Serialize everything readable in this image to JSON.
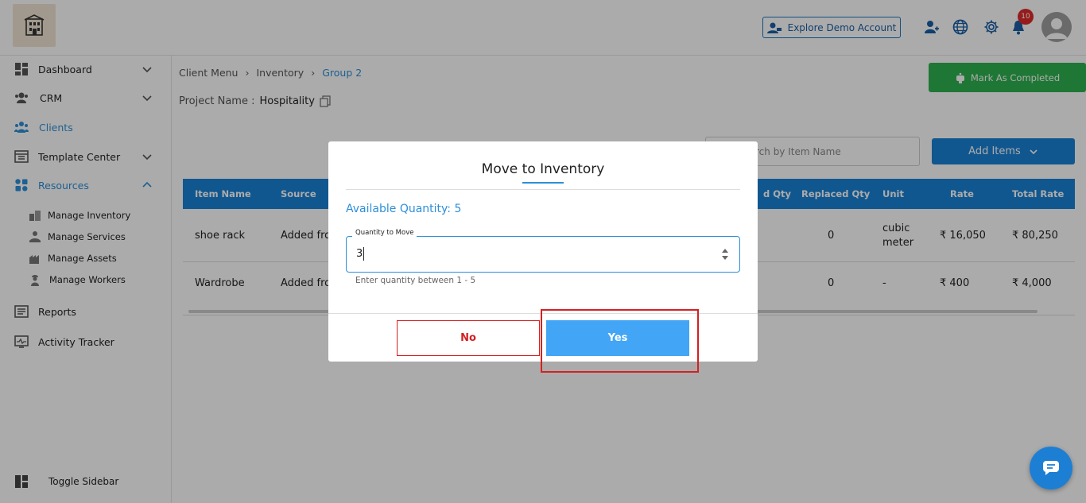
{
  "header": {
    "demo_button": "Explore Demo Account",
    "notification_count": "10"
  },
  "sidebar": {
    "items": [
      {
        "label": "Dashboard"
      },
      {
        "label": "CRM"
      },
      {
        "label": "Clients"
      },
      {
        "label": "Template Center"
      },
      {
        "label": "Resources"
      },
      {
        "label": "Reports"
      },
      {
        "label": "Activity Tracker"
      }
    ],
    "resources_sub": [
      {
        "label": "Manage Inventory"
      },
      {
        "label": "Manage Services"
      },
      {
        "label": "Manage Assets"
      },
      {
        "label": "Manage Workers"
      }
    ],
    "toggle_label": "Toggle Sidebar"
  },
  "breadcrumb": [
    "Client Menu",
    "Inventory",
    "Group 2"
  ],
  "project": {
    "label": "Project Name :",
    "value": "Hospitality"
  },
  "toolbar": {
    "mark_completed": "Mark As Completed",
    "search_placeholder": "Search by Item Name",
    "search_visible": "rch by Item Name",
    "add_items": "Add Items"
  },
  "table": {
    "headers": [
      "Item Name",
      "Source",
      "d Qty",
      "Replaced Qty",
      "Unit",
      "Rate",
      "Total Rate"
    ],
    "rows": [
      {
        "item": "shoe rack",
        "source": "Added fro",
        "replaced": "0",
        "unit_line1": "cubic",
        "unit_line2": "meter",
        "rate": "₹ 16,050",
        "total": "₹ 80,250"
      },
      {
        "item": "Wardrobe",
        "source": "Added fro",
        "replaced": "0",
        "unit_line1": "-",
        "unit_line2": "",
        "rate": "₹ 400",
        "total": "₹ 4,000"
      }
    ]
  },
  "modal": {
    "title": "Move to Inventory",
    "available": "Available Quantity: 5",
    "field_label": "Quantity to Move",
    "field_value": "3",
    "hint": "Enter quantity between 1 - 5",
    "no_label": "No",
    "yes_label": "Yes"
  },
  "colors": {
    "accent": "#2d8fd8",
    "success": "#2fb24f",
    "danger": "#d42020"
  }
}
